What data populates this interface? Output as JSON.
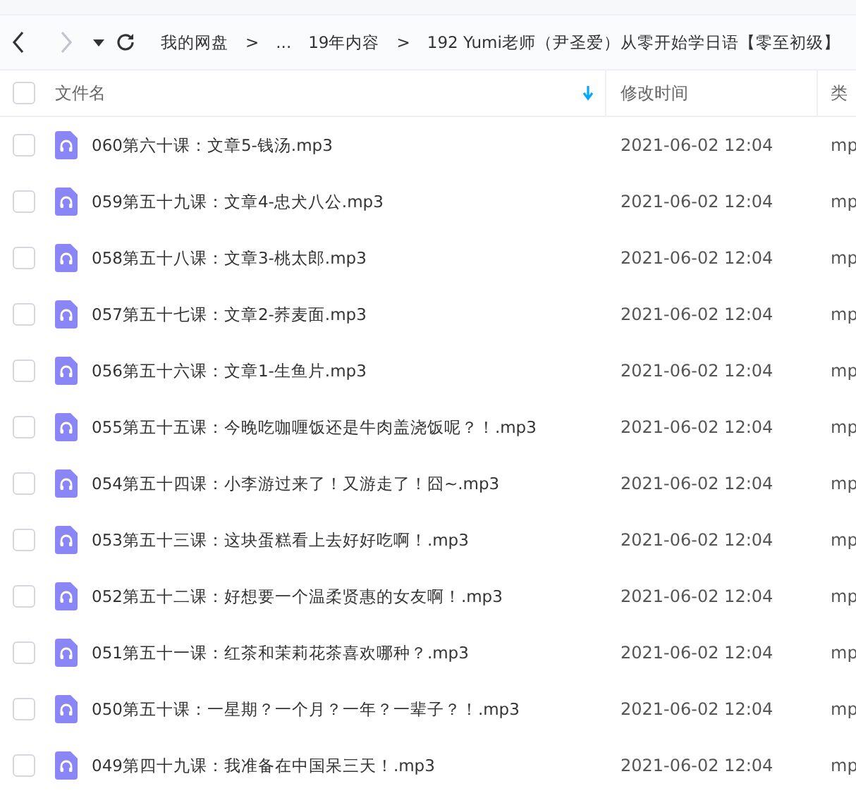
{
  "toolbar": {
    "back_disabled": false,
    "forward_disabled": true
  },
  "breadcrumbs": [
    {
      "kind": "crumb",
      "text": "我的网盘"
    },
    {
      "kind": "sep",
      "text": ">"
    },
    {
      "kind": "crumb",
      "text": "..."
    },
    {
      "kind": "crumb",
      "text": "19年内容"
    },
    {
      "kind": "sep",
      "text": ">"
    },
    {
      "kind": "crumb",
      "text": "192 Yumi老师（尹圣爱）从零开始学日语【零至初级】"
    }
  ],
  "table": {
    "all_checked": false,
    "columns": [
      {
        "label": "文件名",
        "sorted": true
      },
      {
        "label": "修改时间",
        "sorted": false
      },
      {
        "label": "类",
        "sorted": false
      }
    ],
    "rows": [
      {
        "name": "060第六十课：文章5-钱汤.mp3",
        "time": "2021-06-02 12:04",
        "type": "mp",
        "checked": false
      },
      {
        "name": "059第五十九课：文章4-忠犬八公.mp3",
        "time": "2021-06-02 12:04",
        "type": "mp",
        "checked": false
      },
      {
        "name": "058第五十八课：文章3-桃太郎.mp3",
        "time": "2021-06-02 12:04",
        "type": "mp",
        "checked": false
      },
      {
        "name": "057第五十七课：文章2-荞麦面.mp3",
        "time": "2021-06-02 12:04",
        "type": "mp",
        "checked": false
      },
      {
        "name": "056第五十六课：文章1-生鱼片.mp3",
        "time": "2021-06-02 12:04",
        "type": "mp",
        "checked": false
      },
      {
        "name": "055第五十五课：今晚吃咖喱饭还是牛肉盖浇饭呢？！.mp3",
        "time": "2021-06-02 12:04",
        "type": "mp",
        "checked": false
      },
      {
        "name": "054第五十四课：小李游过来了！又游走了！囧~.mp3",
        "time": "2021-06-02 12:04",
        "type": "mp",
        "checked": false
      },
      {
        "name": "053第五十三课：这块蛋糕看上去好好吃啊！.mp3",
        "time": "2021-06-02 12:04",
        "type": "mp",
        "checked": false
      },
      {
        "name": "052第五十二课：好想要一个温柔贤惠的女友啊！.mp3",
        "time": "2021-06-02 12:04",
        "type": "mp",
        "checked": false
      },
      {
        "name": "051第五十一课：红茶和茉莉花茶喜欢哪种？.mp3",
        "time": "2021-06-02 12:04",
        "type": "mp",
        "checked": false
      },
      {
        "name": "050第五十课：一星期？一个月？一年？一辈子？！.mp3",
        "time": "2021-06-02 12:04",
        "type": "mp",
        "checked": false
      },
      {
        "name": "049第四十九课：我准备在中国呆三天！.mp3",
        "time": "2021-06-02 12:04",
        "type": "mp",
        "checked": false
      }
    ]
  }
}
